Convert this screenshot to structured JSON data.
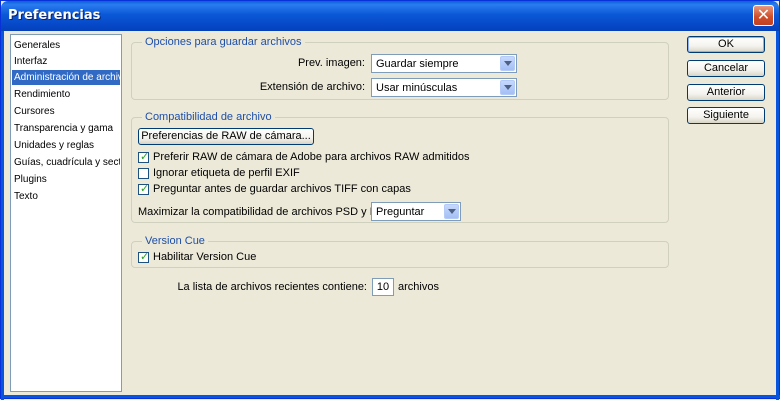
{
  "window": {
    "title": "Preferencias",
    "close_glyph": "✕"
  },
  "sidebar": {
    "items": [
      {
        "label": "Generales"
      },
      {
        "label": "Interfaz"
      },
      {
        "label": "Administración de archivos"
      },
      {
        "label": "Rendimiento"
      },
      {
        "label": "Cursores"
      },
      {
        "label": "Transparencia y gama"
      },
      {
        "label": "Unidades y reglas"
      },
      {
        "label": "Guías, cuadrícula y sectores"
      },
      {
        "label": "Plugins"
      },
      {
        "label": "Texto"
      }
    ],
    "selected": "Administración de archivos"
  },
  "save_options": {
    "legend": "Opciones para guardar archivos",
    "preview_label": "Prev. imagen:",
    "preview_value": "Guardar siempre",
    "extension_label": "Extensión de archivo:",
    "extension_value": "Usar minúsculas"
  },
  "compat": {
    "legend": "Compatibilidad de archivo",
    "raw_prefs_button": "Preferencias de RAW de cámara...",
    "checkboxes": [
      {
        "label": "Preferir RAW de cámara de Adobe para archivos RAW admitidos",
        "checked": true
      },
      {
        "label": "Ignorar etiqueta de perfil EXIF",
        "checked": false
      },
      {
        "label": "Preguntar antes de guardar archivos TIFF con capas",
        "checked": true
      }
    ],
    "psd_label": "Maximizar la compatibilidad de archivos PSD y PSB:",
    "psd_value": "Preguntar"
  },
  "version_cue": {
    "legend": "Version Cue",
    "enable_label": "Habilitar Version Cue",
    "enable_checked": true
  },
  "recent": {
    "label": "La lista de archivos recientes contiene:",
    "value": "10",
    "suffix": "archivos"
  },
  "buttons": {
    "ok": "OK",
    "cancel": "Cancelar",
    "previous": "Anterior",
    "next": "Siguiente"
  },
  "colors": {
    "title_bar": "#0b58d6",
    "selection": "#316ac5",
    "check": "#21a121",
    "legend_text": "#1e4fa8"
  }
}
